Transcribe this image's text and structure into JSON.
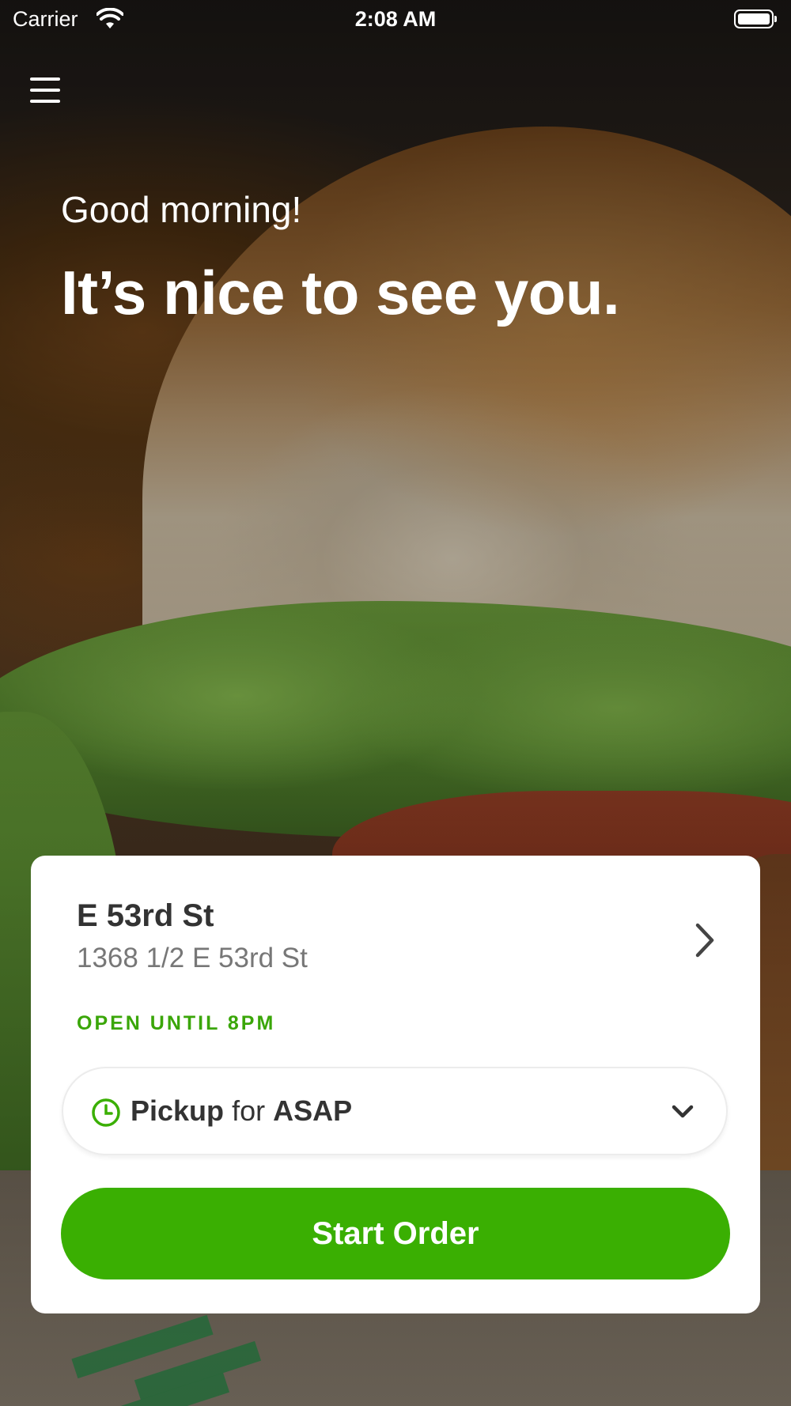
{
  "status_bar": {
    "carrier": "Carrier",
    "time": "2:08 AM",
    "wifi_icon": "wifi-icon",
    "battery_icon": "battery-icon"
  },
  "header": {
    "menu_icon": "menu-icon",
    "greeting": "Good morning!",
    "headline": "It’s nice to see you."
  },
  "store_card": {
    "name": "E 53rd St",
    "address": "1368 1/2 E 53rd St",
    "hours": "OPEN UNTIL 8PM",
    "chevron_icon": "chevron-right-icon",
    "order_mode": {
      "icon": "clock-icon",
      "method": "Pickup",
      "connector": "for",
      "time": "ASAP",
      "dropdown_icon": "chevron-down-icon"
    },
    "start_order_label": "Start Order"
  },
  "colors": {
    "accent_green": "#3aaf02",
    "hours_green": "#3aa608",
    "card_background": "#ffffff",
    "primary_text": "#333333",
    "secondary_text": "#777777"
  }
}
